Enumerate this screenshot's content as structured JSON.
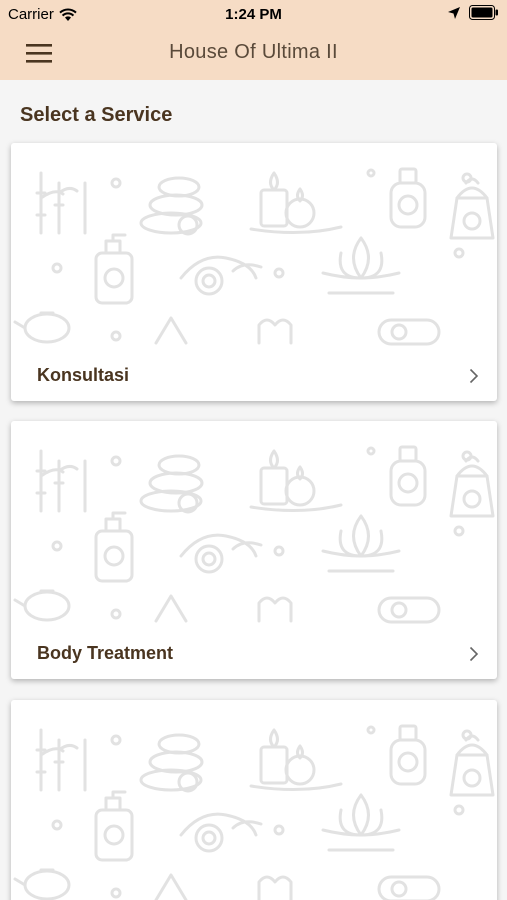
{
  "status": {
    "carrier": "Carrier",
    "time": "1:24 PM"
  },
  "header": {
    "title": "House Of Ultima II",
    "menu_icon": "hamburger-menu-icon",
    "background": "#f6dcc5"
  },
  "page": {
    "section_title": "Select a Service"
  },
  "services": [
    {
      "label": "Konsultasi"
    },
    {
      "label": "Body Treatment"
    },
    {
      "label": ""
    }
  ],
  "colors": {
    "text_brown": "#4a3520",
    "pattern_gray": "#e4e4e4"
  }
}
